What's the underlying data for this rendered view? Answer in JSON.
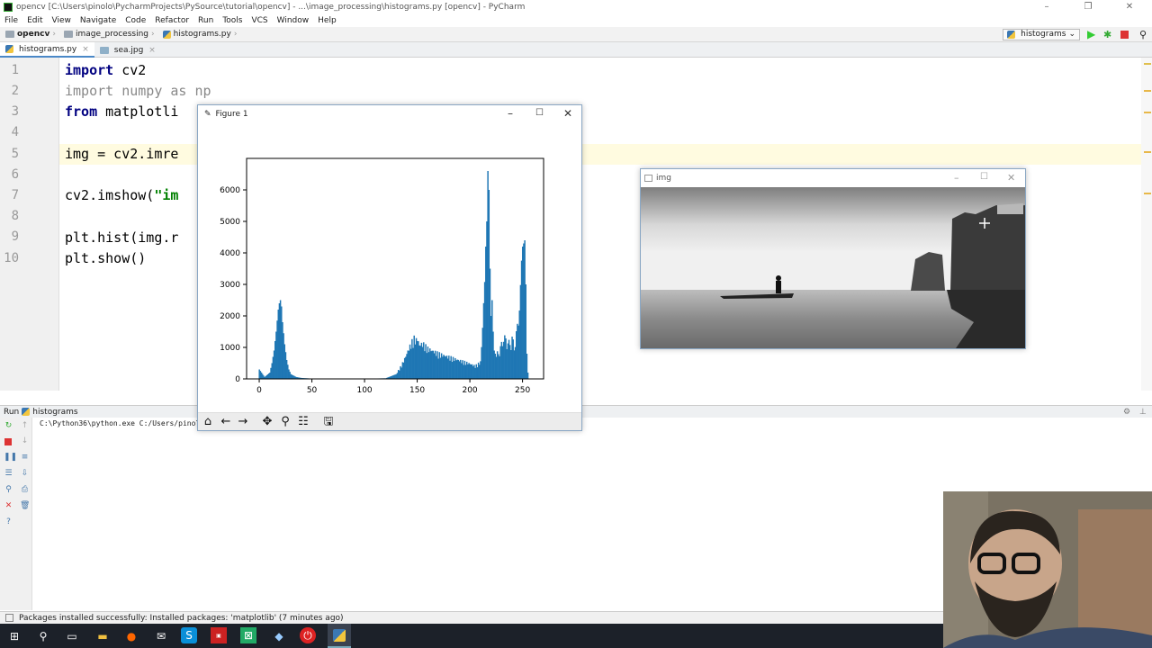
{
  "window": {
    "title": "opencv [C:\\Users\\pinolo\\PycharmProjects\\PySource\\tutorial\\opencv] - ...\\image_processing\\histograms.py [opencv] - PyCharm"
  },
  "menu": [
    "File",
    "Edit",
    "View",
    "Navigate",
    "Code",
    "Refactor",
    "Run",
    "Tools",
    "VCS",
    "Window",
    "Help"
  ],
  "breadcrumb": [
    "opencv",
    "image_processing",
    "histograms.py"
  ],
  "run_config": "histograms",
  "tabs": [
    {
      "label": "histograms.py",
      "active": true
    },
    {
      "label": "sea.jpg",
      "active": false
    }
  ],
  "editor": {
    "line_numbers": [
      "1",
      "2",
      "3",
      "4",
      "5",
      "6",
      "7",
      "8",
      "9",
      "10"
    ],
    "lines": [
      [
        {
          "t": "import",
          "c": "kw"
        },
        {
          "t": " cv2",
          "c": ""
        }
      ],
      [
        {
          "t": "import",
          "c": "mod"
        },
        {
          "t": " numpy ",
          "c": "mod"
        },
        {
          "t": "as",
          "c": "mod"
        },
        {
          "t": " np",
          "c": "mod"
        }
      ],
      [
        {
          "t": "from",
          "c": "kw"
        },
        {
          "t": " matplotli",
          "c": ""
        }
      ],
      [],
      [
        {
          "t": "img = cv2.imre",
          "c": ""
        }
      ],
      [],
      [
        {
          "t": "cv2.imshow(",
          "c": ""
        },
        {
          "t": "\"im",
          "c": "str"
        }
      ],
      [],
      [
        {
          "t": "plt.hist(img.r",
          "c": ""
        }
      ],
      [
        {
          "t": "plt.show()",
          "c": ""
        }
      ]
    ]
  },
  "run_panel": {
    "tab_label": "Run",
    "tab_name": "histograms",
    "console_line": "C:\\Python36\\python.exe C:/Users/pinolo"
  },
  "status": "Packages installed successfully: Installed packages: 'matplotlib' (7 minutes ago)",
  "figure_window": {
    "title": "Figure 1",
    "toolbar": [
      "home-icon",
      "back-icon",
      "forward-icon",
      "pan-icon",
      "zoom-icon",
      "configure-icon",
      "save-icon"
    ]
  },
  "img_window": {
    "title": "img"
  },
  "colors": {
    "bar": "#1f77b4",
    "keyword": "#000080",
    "string": "#008000",
    "current_line": "#fffbe0"
  },
  "chart_data": {
    "type": "bar",
    "title": "",
    "xlabel": "",
    "ylabel": "",
    "xlim": [
      -12,
      270
    ],
    "ylim": [
      0,
      7000
    ],
    "xticks": [
      0,
      50,
      100,
      150,
      200,
      250
    ],
    "yticks": [
      1000,
      2000,
      3000,
      4000,
      5000,
      6000
    ],
    "ytick_labels_visible": [
      "0",
      "1000",
      "2000",
      "3000",
      "4000",
      "5000",
      "6000"
    ],
    "x": [
      0,
      5,
      10,
      12,
      14,
      16,
      18,
      19,
      20,
      21,
      22,
      24,
      26,
      28,
      30,
      35,
      40,
      50,
      70,
      100,
      120,
      130,
      135,
      138,
      140,
      142,
      145,
      147,
      149,
      150,
      152,
      155,
      160,
      170,
      180,
      190,
      200,
      205,
      210,
      212,
      214,
      215,
      216,
      217,
      218,
      219,
      220,
      221,
      222,
      223,
      225,
      228,
      230,
      232,
      235,
      238,
      240,
      242,
      245,
      248,
      250,
      252,
      253,
      254,
      255
    ],
    "values": [
      300,
      60,
      200,
      500,
      900,
      1500,
      2200,
      2400,
      2500,
      2300,
      1800,
      1100,
      600,
      300,
      150,
      60,
      30,
      10,
      5,
      5,
      20,
      150,
      400,
      600,
      750,
      900,
      1100,
      1200,
      1150,
      1200,
      1000,
      1050,
      900,
      750,
      650,
      550,
      450,
      380,
      500,
      1500,
      3000,
      4200,
      5000,
      6600,
      6000,
      3500,
      2000,
      2500,
      1500,
      900,
      700,
      800,
      1000,
      1200,
      1100,
      1000,
      1200,
      900,
      1500,
      2500,
      4200,
      4400,
      3000,
      800,
      200
    ]
  }
}
